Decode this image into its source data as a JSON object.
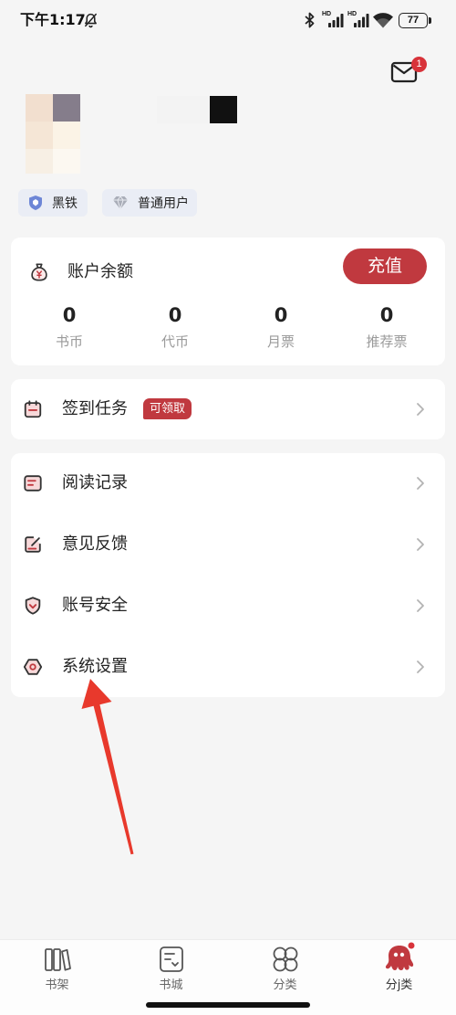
{
  "status_bar": {
    "time": "下午1:17",
    "network_1": "HD",
    "network_2": "HD",
    "battery": "77",
    "icons": [
      "bell-off-icon",
      "bluetooth-icon",
      "signal-icon",
      "signal-icon",
      "wifi-icon",
      "battery-icon"
    ]
  },
  "header": {
    "mail_icon": "mail-icon",
    "mail_badge_count": "1"
  },
  "profile": {
    "badges": [
      {
        "label": "黑铁",
        "icon": "shield-icon"
      },
      {
        "label": "普通用户",
        "icon": "diamond-icon"
      }
    ]
  },
  "balance": {
    "icon": "money-bag-icon",
    "title": "账户余额",
    "recharge_label": "充值",
    "stats": [
      {
        "value": "0",
        "label": "书币"
      },
      {
        "value": "0",
        "label": "代币"
      },
      {
        "value": "0",
        "label": "月票"
      },
      {
        "value": "0",
        "label": "推荐票"
      }
    ]
  },
  "checkin": {
    "icon": "calendar-icon",
    "label": "签到任务",
    "badge": "可领取"
  },
  "menu": [
    {
      "icon": "reading-record-icon",
      "label": "阅读记录"
    },
    {
      "icon": "feedback-icon",
      "label": "意见反馈"
    },
    {
      "icon": "account-security-icon",
      "label": "账号安全"
    },
    {
      "icon": "settings-icon",
      "label": "系统设置"
    }
  ],
  "tabbar": {
    "items": [
      {
        "icon": "bookshelf-icon",
        "label": "书架",
        "active": false
      },
      {
        "icon": "bookstore-icon",
        "label": "书城",
        "active": false
      },
      {
        "icon": "category-icon",
        "label": "分类",
        "active": false
      },
      {
        "icon": "mascot-icon",
        "label": "分j类",
        "active": true
      }
    ]
  },
  "colors": {
    "accent": "#c0393f",
    "background": "#f5f5f5",
    "card": "#ffffff",
    "secondary_text": "#9a9a9a",
    "annotation_arrow": "#e8392c"
  }
}
